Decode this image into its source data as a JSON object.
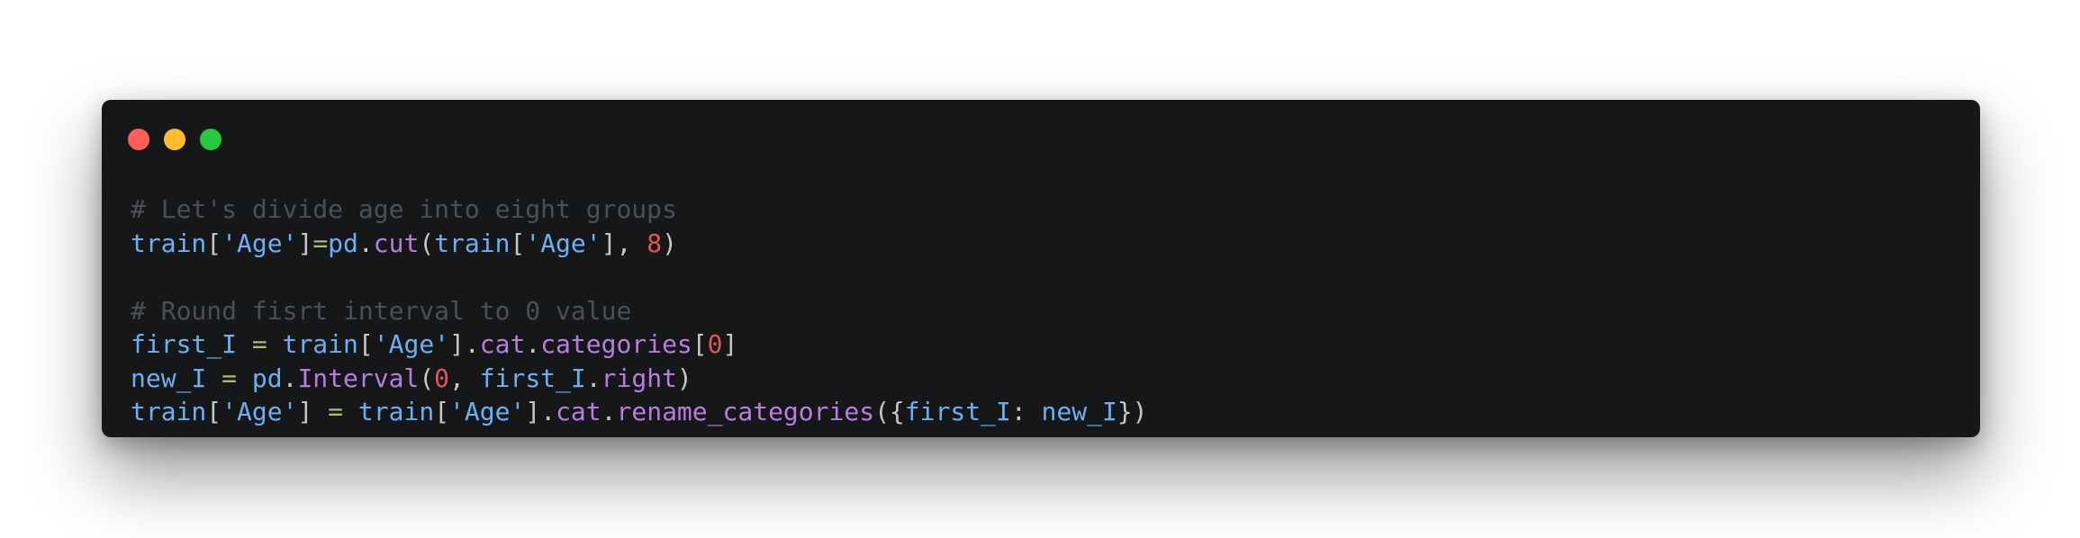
{
  "window": {
    "controls": [
      {
        "name": "close",
        "color": "#ff5f56"
      },
      {
        "name": "minimize",
        "color": "#ffbd2e"
      },
      {
        "name": "maximize",
        "color": "#27c93f"
      }
    ]
  },
  "code": {
    "language": "python",
    "lines": [
      {
        "tokens": [
          {
            "text": "# Let's divide age into eight groups",
            "kind": "comment"
          }
        ]
      },
      {
        "tokens": [
          {
            "text": "train",
            "kind": "var"
          },
          {
            "text": "[",
            "kind": "op"
          },
          {
            "text": "'Age'",
            "kind": "str"
          },
          {
            "text": "]",
            "kind": "op"
          },
          {
            "text": "=",
            "kind": "eq"
          },
          {
            "text": "pd",
            "kind": "var"
          },
          {
            "text": ".",
            "kind": "op"
          },
          {
            "text": "cut",
            "kind": "call"
          },
          {
            "text": "(",
            "kind": "op"
          },
          {
            "text": "train",
            "kind": "var"
          },
          {
            "text": "[",
            "kind": "op"
          },
          {
            "text": "'Age'",
            "kind": "str"
          },
          {
            "text": "], ",
            "kind": "op"
          },
          {
            "text": "8",
            "kind": "num"
          },
          {
            "text": ")",
            "kind": "op"
          }
        ]
      },
      {
        "tokens": []
      },
      {
        "tokens": [
          {
            "text": "# Round fisrt interval to 0 value",
            "kind": "comment"
          }
        ]
      },
      {
        "tokens": [
          {
            "text": "first_I",
            "kind": "var"
          },
          {
            "text": " ",
            "kind": "op"
          },
          {
            "text": "=",
            "kind": "eq"
          },
          {
            "text": " ",
            "kind": "op"
          },
          {
            "text": "train",
            "kind": "var"
          },
          {
            "text": "[",
            "kind": "op"
          },
          {
            "text": "'Age'",
            "kind": "str"
          },
          {
            "text": "].",
            "kind": "op"
          },
          {
            "text": "cat",
            "kind": "call"
          },
          {
            "text": ".",
            "kind": "op"
          },
          {
            "text": "categories",
            "kind": "call"
          },
          {
            "text": "[",
            "kind": "op"
          },
          {
            "text": "0",
            "kind": "num"
          },
          {
            "text": "]",
            "kind": "op"
          }
        ]
      },
      {
        "tokens": [
          {
            "text": "new_I",
            "kind": "var"
          },
          {
            "text": " ",
            "kind": "op"
          },
          {
            "text": "=",
            "kind": "eq"
          },
          {
            "text": " ",
            "kind": "op"
          },
          {
            "text": "pd",
            "kind": "var"
          },
          {
            "text": ".",
            "kind": "op"
          },
          {
            "text": "Interval",
            "kind": "call"
          },
          {
            "text": "(",
            "kind": "op"
          },
          {
            "text": "0",
            "kind": "num"
          },
          {
            "text": ", ",
            "kind": "op"
          },
          {
            "text": "first_I",
            "kind": "var"
          },
          {
            "text": ".",
            "kind": "op"
          },
          {
            "text": "right",
            "kind": "call"
          },
          {
            "text": ")",
            "kind": "op"
          }
        ]
      },
      {
        "tokens": [
          {
            "text": "train",
            "kind": "var"
          },
          {
            "text": "[",
            "kind": "op"
          },
          {
            "text": "'Age'",
            "kind": "str"
          },
          {
            "text": "] ",
            "kind": "op"
          },
          {
            "text": "=",
            "kind": "eq"
          },
          {
            "text": " ",
            "kind": "op"
          },
          {
            "text": "train",
            "kind": "var"
          },
          {
            "text": "[",
            "kind": "op"
          },
          {
            "text": "'Age'",
            "kind": "str"
          },
          {
            "text": "].",
            "kind": "op"
          },
          {
            "text": "cat",
            "kind": "call"
          },
          {
            "text": ".",
            "kind": "op"
          },
          {
            "text": "rename_categories",
            "kind": "call"
          },
          {
            "text": "({",
            "kind": "op"
          },
          {
            "text": "first_I",
            "kind": "var"
          },
          {
            "text": ": ",
            "kind": "op"
          },
          {
            "text": "new_I",
            "kind": "var"
          },
          {
            "text": "})",
            "kind": "op"
          }
        ]
      }
    ]
  }
}
